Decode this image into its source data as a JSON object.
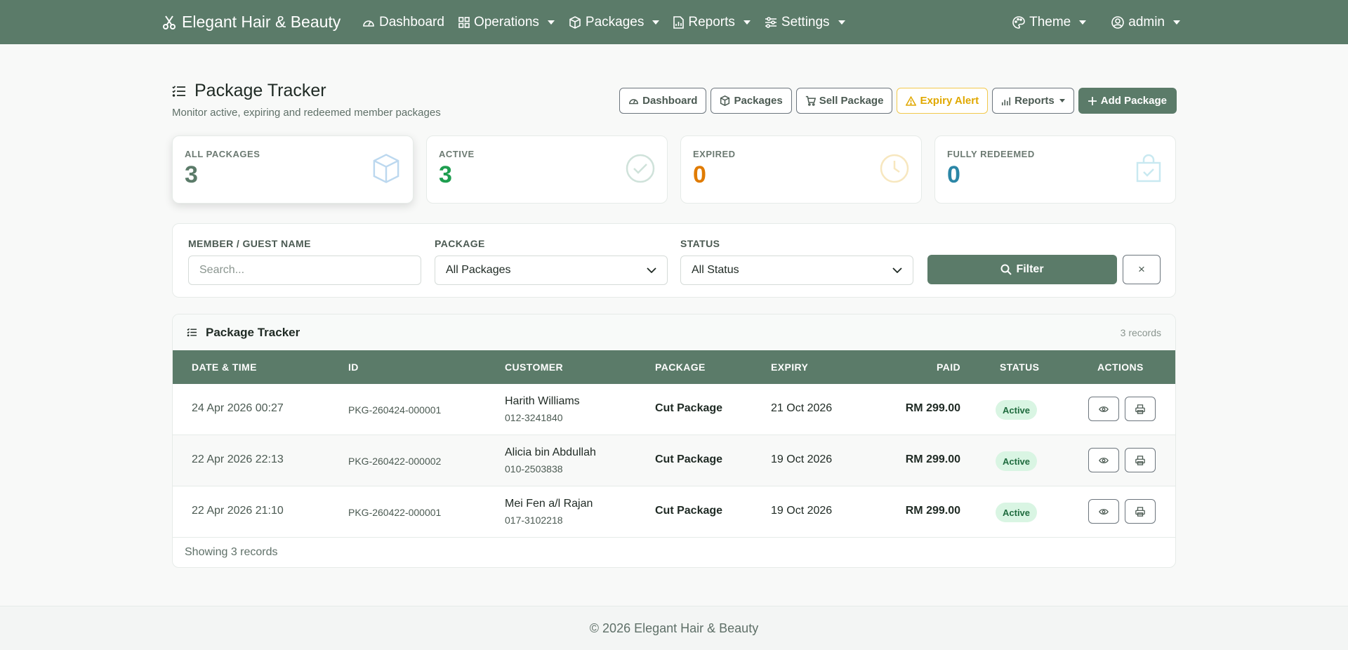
{
  "nav": {
    "brand": "Elegant Hair & Beauty",
    "items": [
      {
        "label": "Dashboard",
        "icon": "gauge-icon",
        "dropdown": false
      },
      {
        "label": "Operations",
        "icon": "grid-icon",
        "dropdown": true
      },
      {
        "label": "Packages",
        "icon": "box-icon",
        "dropdown": true
      },
      {
        "label": "Reports",
        "icon": "file-chart-icon",
        "dropdown": true
      },
      {
        "label": "Settings",
        "icon": "sliders-icon",
        "dropdown": true
      }
    ],
    "theme_label": "Theme",
    "user_label": "admin"
  },
  "header": {
    "title": "Package Tracker",
    "subtitle": "Monitor active, expiring and redeemed member packages",
    "actions": {
      "dashboard": "Dashboard",
      "packages": "Packages",
      "sell_package": "Sell Package",
      "expiry_alert": "Expiry Alert",
      "reports": "Reports",
      "add_package": "Add Package"
    }
  },
  "stats": [
    {
      "label": "ALL PACKAGES",
      "value": "3",
      "color": "#5b7b69",
      "icon": "box-icon"
    },
    {
      "label": "ACTIVE",
      "value": "3",
      "color": "#1e9e4f",
      "icon": "check-circle-icon"
    },
    {
      "label": "EXPIRED",
      "value": "0",
      "color": "#e07b00",
      "icon": "clock-icon"
    },
    {
      "label": "FULLY REDEEMED",
      "value": "0",
      "color": "#2b86a6",
      "icon": "bag-check-icon"
    }
  ],
  "filters": {
    "member_label": "MEMBER / GUEST NAME",
    "member_placeholder": "Search...",
    "package_label": "PACKAGE",
    "package_value": "All Packages",
    "status_label": "STATUS",
    "status_value": "All Status",
    "filter_button": "Filter",
    "clear_button": "×"
  },
  "table": {
    "title": "Package Tracker",
    "count": "3 records",
    "columns": {
      "date": "DATE & TIME",
      "id": "ID",
      "customer": "CUSTOMER",
      "package": "PACKAGE",
      "expiry": "EXPIRY",
      "paid": "PAID",
      "status": "STATUS",
      "actions": "ACTIONS"
    },
    "rows": [
      {
        "date": "24 Apr 2026 00:27",
        "id": "PKG-260424-000001",
        "name": "Harith Williams",
        "phone": "012-3241840",
        "package": "Cut Package",
        "expiry": "21 Oct 2026",
        "paid": "RM 299.00",
        "status": "Active"
      },
      {
        "date": "22 Apr 2026 22:13",
        "id": "PKG-260422-000002",
        "name": "Alicia bin Abdullah",
        "phone": "010-2503838",
        "package": "Cut Package",
        "expiry": "19 Oct 2026",
        "paid": "RM 299.00",
        "status": "Active"
      },
      {
        "date": "22 Apr 2026 21:10",
        "id": "PKG-260422-000001",
        "name": "Mei Fen a/l Rajan",
        "phone": "017-3102218",
        "package": "Cut Package",
        "expiry": "19 Oct 2026",
        "paid": "RM 299.00",
        "status": "Active"
      }
    ],
    "footer": "Showing 3 records"
  },
  "footer": {
    "text": "© 2026 Elegant Hair & Beauty"
  }
}
